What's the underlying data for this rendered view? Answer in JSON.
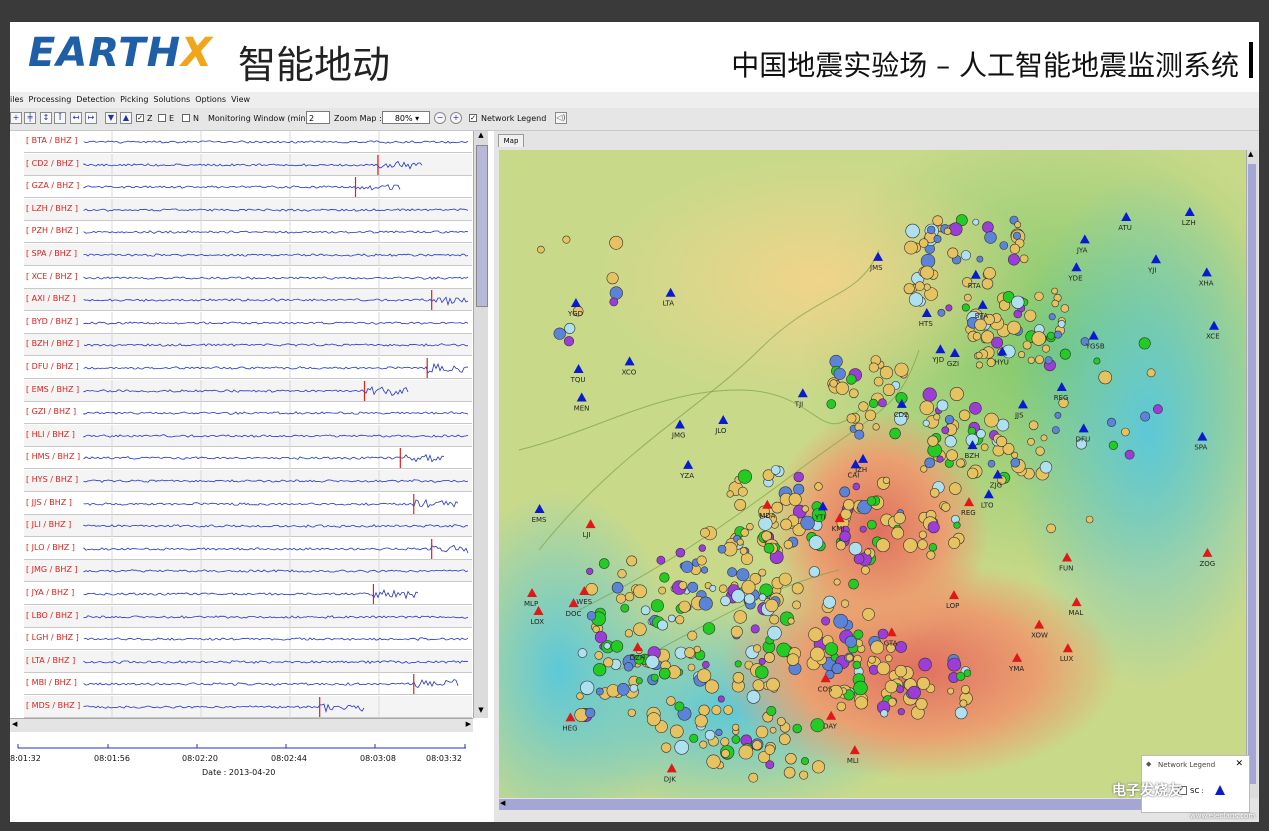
{
  "banner": {
    "logo_text_main": "EARTH",
    "logo_text_x": "X",
    "brand_cn": "智能地动",
    "system_title": "中国地震实验场 – 人工智能地震监测系统"
  },
  "menu": [
    "iles",
    "Processing",
    "Detection",
    "Picking",
    "Solutions",
    "Options",
    "View"
  ],
  "toolbar": {
    "chk_z": "Z",
    "chk_e": "E",
    "chk_n": "N",
    "monitoring_label": "Monitoring Window (min)",
    "monitoring_value": "2",
    "zoom_label": "Zoom Map :",
    "zoom_value": "80%",
    "network_legend_label": "Network Legend"
  },
  "traces": [
    {
      "label": "[ BTA / BHZ ]",
      "pick": null
    },
    {
      "label": "[ CD2 / BHZ ]",
      "pick": 0.79
    },
    {
      "label": "[ GZA / BHZ ]",
      "pick": 0.74
    },
    {
      "label": "[ LZH / BHZ ]",
      "pick": null
    },
    {
      "label": "[ PZH / BHZ ]",
      "pick": null
    },
    {
      "label": "[ SPA / BHZ ]",
      "pick": null
    },
    {
      "label": "[ XCE / BHZ ]",
      "pick": null
    },
    {
      "label": "[ AXI / BHZ ]",
      "pick": 0.91
    },
    {
      "label": "[ BYD / BHZ ]",
      "pick": null
    },
    {
      "label": "[ BZH / BHZ ]",
      "pick": null
    },
    {
      "label": "[ DFU / BHZ ]",
      "pick": 0.9
    },
    {
      "label": "[ EMS / BHZ ]",
      "pick": 0.76
    },
    {
      "label": "[ GZI / BHZ ]",
      "pick": null
    },
    {
      "label": "[ HLI / BHZ ]",
      "pick": null
    },
    {
      "label": "[ HMS / BHZ ]",
      "pick": 0.84
    },
    {
      "label": "[ HYS / BHZ ]",
      "pick": null
    },
    {
      "label": "[ JJS / BHZ ]",
      "pick": 0.87
    },
    {
      "label": "[ JLI / BHZ ]",
      "pick": null
    },
    {
      "label": "[ JLO / BHZ ]",
      "pick": 0.91
    },
    {
      "label": "[ JMG / BHZ ]",
      "pick": null
    },
    {
      "label": "[ JYA / BHZ ]",
      "pick": 0.78
    },
    {
      "label": "[ LBO / BHZ ]",
      "pick": null
    },
    {
      "label": "[ LGH / BHZ ]",
      "pick": null
    },
    {
      "label": "[ LTA / BHZ ]",
      "pick": null
    },
    {
      "label": "[ MBI / BHZ ]",
      "pick": 0.87
    },
    {
      "label": "[ MDS / BHZ ]",
      "pick": 0.66
    }
  ],
  "time_axis": {
    "ticks": [
      "8:01:32",
      "08:01:56",
      "08:02:20",
      "08:02:44",
      "08:03:08",
      "08:03:32"
    ],
    "date": "Date : 2013-04-20"
  },
  "map": {
    "tab_label": "Map",
    "stations_blue": [
      "REG",
      "HYU",
      "RTA",
      "MEN",
      "GZI",
      "DFU",
      "BTA",
      "LTA",
      "YJI",
      "XCE",
      "LTO",
      "YZA",
      "TQU",
      "CD2",
      "JJS",
      "YGD",
      "EMS",
      "TJI",
      "ATU",
      "JMG",
      "ZJG",
      "XCO",
      "YTI",
      "CAI",
      "BZH",
      "XHA",
      "HTS",
      "LZH",
      "YJD",
      "JZH",
      "YGSB",
      "YDE",
      "JMS",
      "SPA",
      "JLO",
      "JYA"
    ],
    "stations_red": [
      "COS",
      "ZOG",
      "REG",
      "MLI",
      "KMI",
      "LOX",
      "FUN",
      "MDA",
      "DJK",
      "MAL",
      "LOP",
      "GTA",
      "WES",
      "MLP",
      "XOW",
      "DOC",
      "LUX",
      "DAY",
      "LJI",
      "HEG",
      "YMA",
      "DZH"
    ],
    "legend_title": "Network Legend",
    "legend_item": "SC :"
  },
  "watermark": {
    "text": "电子发烧友",
    "sub": "www.elecfans.com"
  },
  "colors": {
    "trace": "#2233cc",
    "pick": "#e0201c",
    "label": "#e0201c",
    "station_blue": "#0a1ad0",
    "station_red": "#e01818"
  }
}
